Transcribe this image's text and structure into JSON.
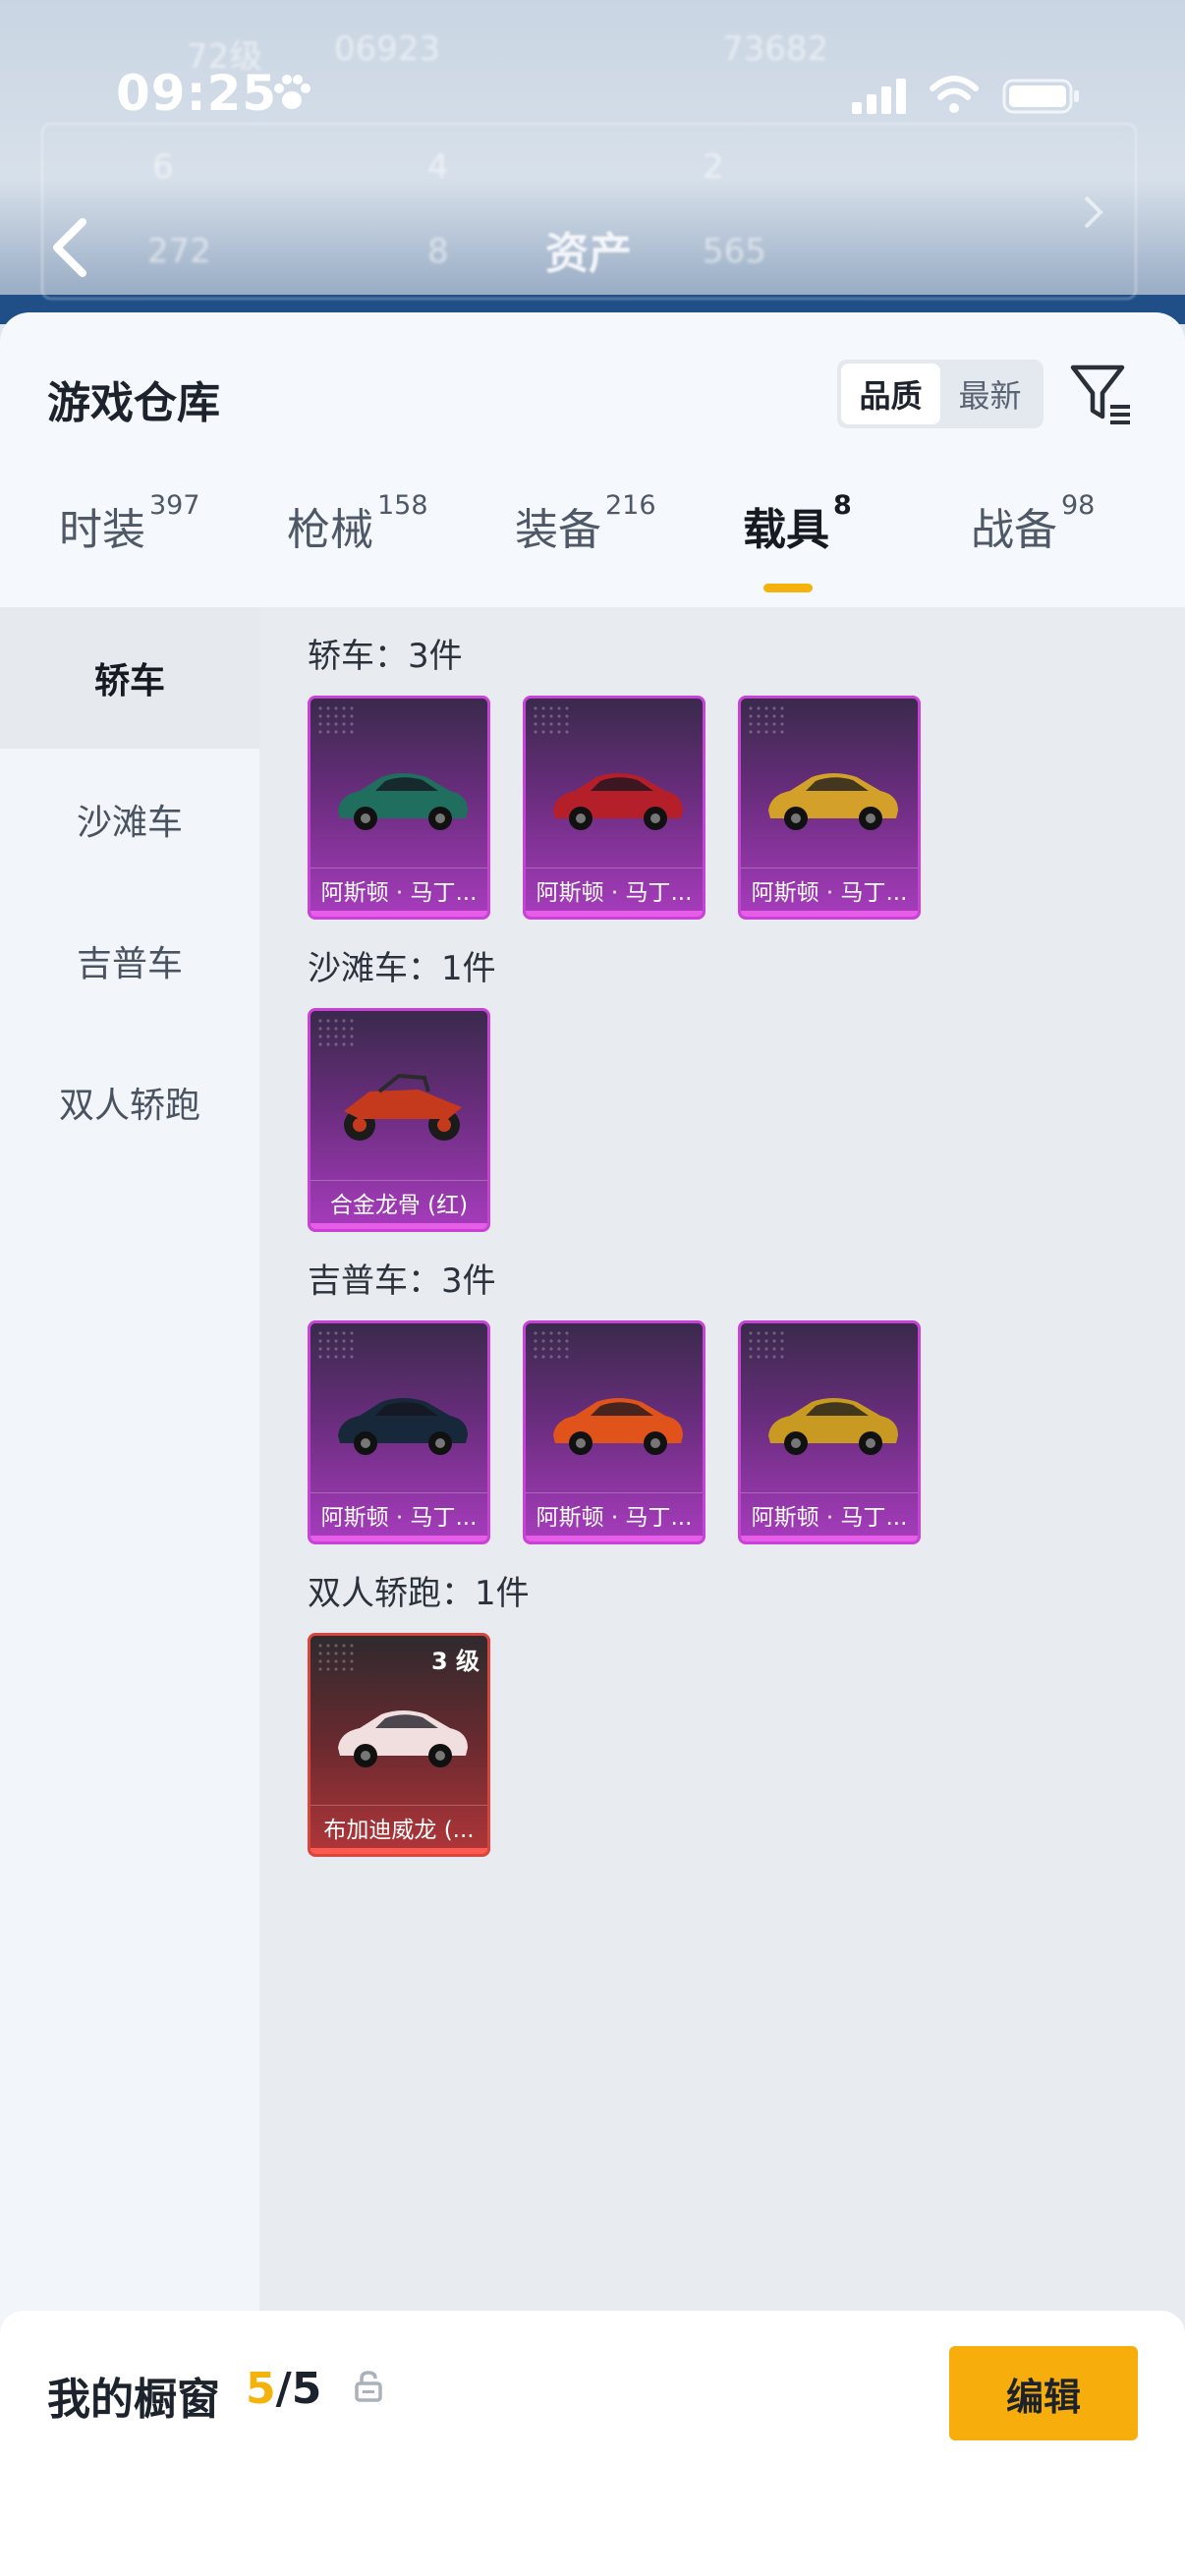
{
  "status_bar": {
    "time": "09:25"
  },
  "header": {
    "title": "资产",
    "ghost_level": "72级",
    "ghost_a": "06923",
    "ghost_b": "73682",
    "stats": [
      "6",
      "4",
      "2",
      "272",
      "8",
      "565"
    ]
  },
  "warehouse": {
    "title": "游戏仓库",
    "sort_options": [
      {
        "label": "品质",
        "active": true
      },
      {
        "label": "最新",
        "active": false
      }
    ]
  },
  "tabs": [
    {
      "label": "时装",
      "count": "397",
      "active": false
    },
    {
      "label": "枪械",
      "count": "158",
      "active": false
    },
    {
      "label": "装备",
      "count": "216",
      "active": false
    },
    {
      "label": "载具",
      "count": "8",
      "active": true
    },
    {
      "label": "战备",
      "count": "98",
      "active": false
    }
  ],
  "side_nav": [
    {
      "label": "轿车",
      "active": true
    },
    {
      "label": "沙滩车",
      "active": false
    },
    {
      "label": "吉普车",
      "active": false
    },
    {
      "label": "双人轿跑",
      "active": false
    }
  ],
  "groups": [
    {
      "title": "轿车：3件",
      "items": [
        {
          "name": "阿斯顿 · 马丁...",
          "color": "#1f6e5e",
          "tier": "purple"
        },
        {
          "name": "阿斯顿 · 马丁...",
          "color": "#b51f2a",
          "tier": "purple"
        },
        {
          "name": "阿斯顿 · 马丁...",
          "color": "#d3a12a",
          "tier": "purple"
        }
      ]
    },
    {
      "title": "沙滩车：1件",
      "items": [
        {
          "name": "合金龙骨 (红)",
          "color": "#c53a1c",
          "tier": "purple"
        }
      ]
    },
    {
      "title": "吉普车：3件",
      "items": [
        {
          "name": "阿斯顿 · 马丁...",
          "color": "#16283a",
          "tier": "purple"
        },
        {
          "name": "阿斯顿 · 马丁...",
          "color": "#e0541c",
          "tier": "purple"
        },
        {
          "name": "阿斯顿 · 马丁...",
          "color": "#c89a22",
          "tier": "purple"
        }
      ]
    },
    {
      "title": "双人轿跑：1件",
      "items": [
        {
          "name": "布加迪威龙 (...",
          "color": "#f1dede",
          "tier": "red",
          "level": "3 级"
        }
      ]
    }
  ],
  "showcase": {
    "label": "我的橱窗",
    "current": "5",
    "total": "/5"
  },
  "edit_button": "编辑",
  "colors": {
    "accent": "#f7ad0c",
    "purple_tier": "#c742d6",
    "red_tier": "#d9443c"
  }
}
